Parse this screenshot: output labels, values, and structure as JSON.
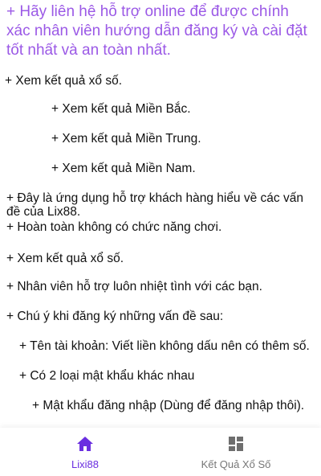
{
  "notice": {
    "text": "+ Hãy liên hệ hỗ trợ online để được chính xác nhân viên hướng dẫn đăng ký và cài đặt tốt nhất và an toàn nhất."
  },
  "content": {
    "lines": [
      "+ Xem kết quả xổ số.",
      "+ Xem kết quả Miền Bắc.",
      "+ Xem kết quả Miền Trung.",
      "+ Xem kết quả Miền Nam.",
      "+ Đây là ứng dụng hỗ trợ khách hàng hiểu về các vấn đề của Lix88.",
      "+ Hoàn toàn không có chức năng chơi.",
      "+ Xem kết quả xổ số.",
      "+ Nhân viên hỗ trợ luôn nhiệt tình với các bạn.",
      "+ Chú ý khi đăng ký những vấn đề sau:",
      "+ Tên tài khoản: Viết liền không dấu nên có thêm số.",
      "+ Có 2 loại mật khẩu khác nhau",
      "+ Mật khẩu đăng nhập (Dùng để đăng nhập thôi)."
    ]
  },
  "bottom_nav": {
    "items": [
      {
        "label": "Lixi88",
        "icon": "home-icon",
        "active": true
      },
      {
        "label": "Kết Quả Xổ Số",
        "icon": "grid-icon",
        "active": false
      }
    ],
    "active_color": "#6a2ee0",
    "inactive_color": "#777777"
  },
  "colors": {
    "notice": "#9b59e6",
    "text": "#111111"
  }
}
